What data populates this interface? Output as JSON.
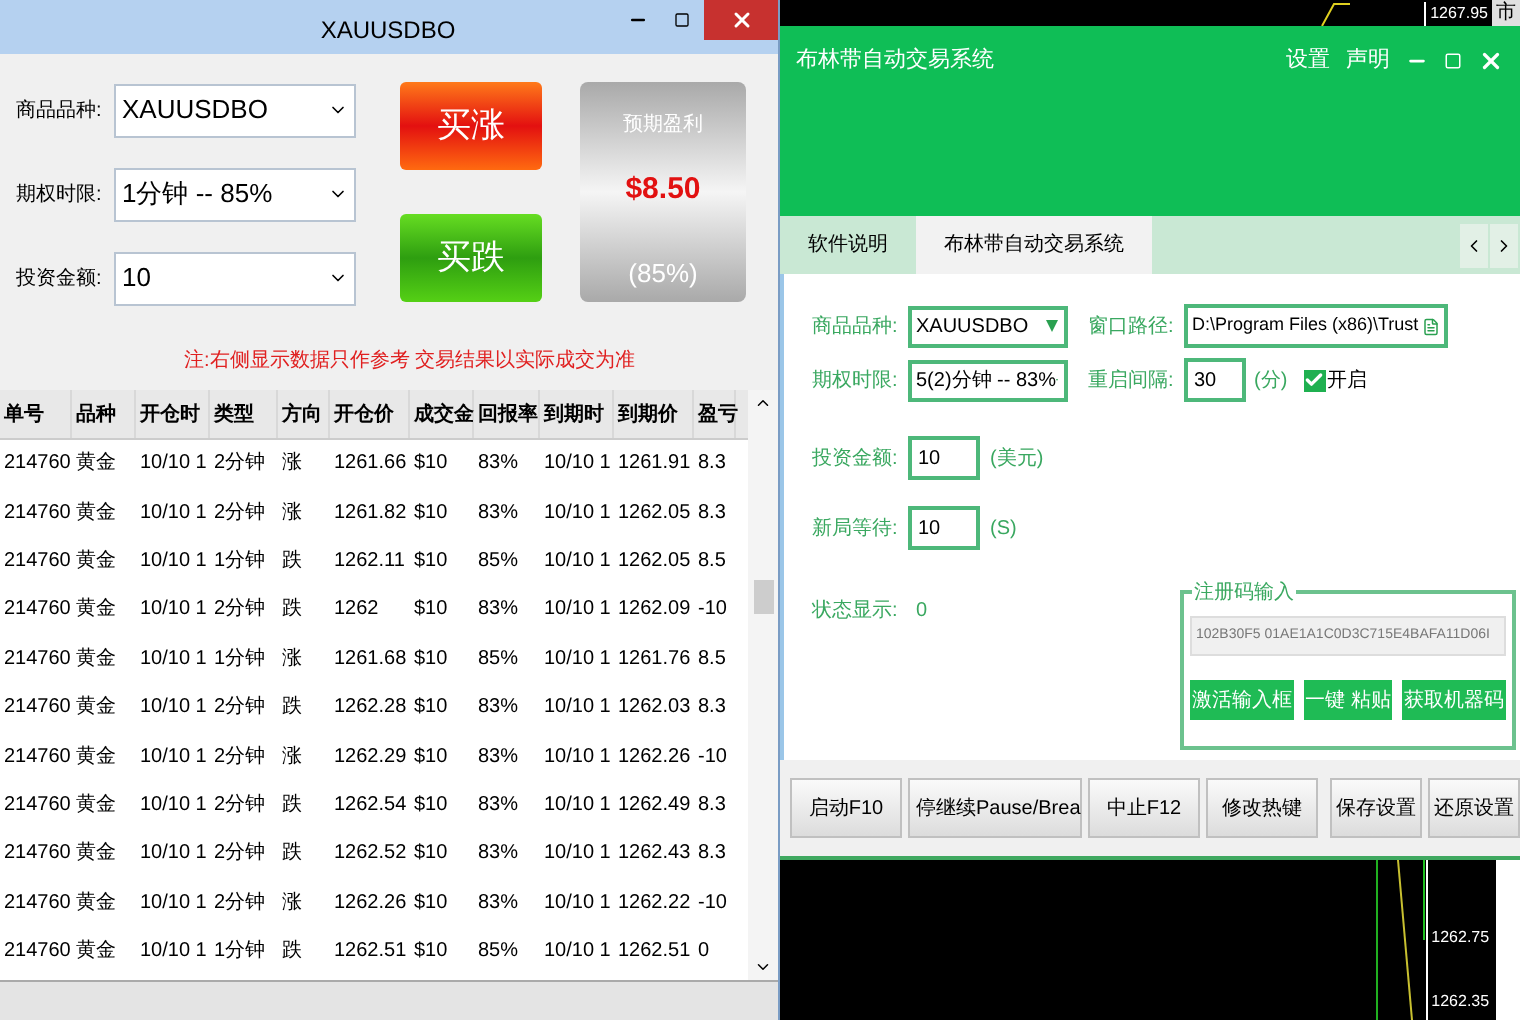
{
  "left_window": {
    "title": "XAUUSDBO",
    "fields": [
      {
        "label": "商品品种:",
        "value": "XAUUSDBO"
      },
      {
        "label": "期权时限:",
        "value": "1分钟 -- 85%"
      },
      {
        "label": "投资金额:",
        "value": "10"
      }
    ],
    "buy_up": "买涨",
    "buy_down": "买跌",
    "profit": {
      "title": "预期盈利",
      "amount": "$8.50",
      "rate": "(85%)"
    },
    "note": "注:右侧显示数据只作参考 交易结果以实际成交为准",
    "table": {
      "columns": [
        "单号",
        "品种",
        "开仓时",
        "类型",
        "方向",
        "开仓价",
        "成交金",
        "回报率",
        "到期时",
        "到期价",
        "盈亏"
      ],
      "rows": [
        [
          "214760",
          "黄金",
          "10/10 1",
          "2分钟",
          "涨",
          "1261.66",
          "$10",
          "83%",
          "10/10 1",
          "1261.91",
          "8.3"
        ],
        [
          "214760",
          "黄金",
          "10/10 1",
          "2分钟",
          "涨",
          "1261.82",
          "$10",
          "83%",
          "10/10 1",
          "1262.05",
          "8.3"
        ],
        [
          "214760",
          "黄金",
          "10/10 1",
          "1分钟",
          "跌",
          "1262.11",
          "$10",
          "85%",
          "10/10 1",
          "1262.05",
          "8.5"
        ],
        [
          "214760",
          "黄金",
          "10/10 1",
          "2分钟",
          "跌",
          "1262",
          "$10",
          "83%",
          "10/10 1",
          "1262.09",
          "-10"
        ],
        [
          "214760",
          "黄金",
          "10/10 1",
          "1分钟",
          "涨",
          "1261.68",
          "$10",
          "85%",
          "10/10 1",
          "1261.76",
          "8.5"
        ],
        [
          "214760",
          "黄金",
          "10/10 1",
          "2分钟",
          "跌",
          "1262.28",
          "$10",
          "83%",
          "10/10 1",
          "1262.03",
          "8.3"
        ],
        [
          "214760",
          "黄金",
          "10/10 1",
          "2分钟",
          "涨",
          "1262.29",
          "$10",
          "83%",
          "10/10 1",
          "1262.26",
          "-10"
        ],
        [
          "214760",
          "黄金",
          "10/10 1",
          "2分钟",
          "跌",
          "1262.54",
          "$10",
          "83%",
          "10/10 1",
          "1262.49",
          "8.3"
        ],
        [
          "214760",
          "黄金",
          "10/10 1",
          "2分钟",
          "跌",
          "1262.52",
          "$10",
          "83%",
          "10/10 1",
          "1262.43",
          "8.3"
        ],
        [
          "214760",
          "黄金",
          "10/10 1",
          "2分钟",
          "涨",
          "1262.26",
          "$10",
          "83%",
          "10/10 1",
          "1262.22",
          "-10"
        ],
        [
          "214760",
          "黄金",
          "10/10 1",
          "1分钟",
          "跌",
          "1262.51",
          "$10",
          "85%",
          "10/10 1",
          "1262.51",
          "0"
        ]
      ]
    }
  },
  "right_window": {
    "chart_top": {
      "price": "1267.95",
      "label": "市"
    },
    "title": "布林带自动交易系统",
    "header_links": [
      "设置",
      "声明"
    ],
    "tabs": [
      {
        "label": "软件说明",
        "selected": false
      },
      {
        "label": "布林带自动交易系统",
        "selected": true
      }
    ],
    "product": {
      "label": "商品品种:",
      "value": "XAUUSDBO"
    },
    "path": {
      "label": "窗口路径:",
      "value": "D:\\Program Files (x86)\\Trust"
    },
    "period": {
      "label": "期权时限:",
      "value": "5(2)分钟 -- 83%"
    },
    "restart": {
      "label": "重启间隔:",
      "value": "30",
      "unit": "(分)"
    },
    "enable": {
      "label": "开启",
      "checked": true
    },
    "amount": {
      "label": "投资金额:",
      "value": "10",
      "unit": "(美元)"
    },
    "wait": {
      "label": "新局等待:",
      "value": "10",
      "unit": "(S)"
    },
    "status": {
      "label": "状态显示:",
      "value": "0"
    },
    "registration": {
      "title": "注册码输入",
      "code": "102B30F5 01AE1A1C0D3C715E4BAFA11D06I",
      "buttons": [
        "激活输入框",
        "一键 粘贴",
        "获取机器码"
      ]
    },
    "actions": [
      "启动F10",
      "停继续Pause/Brea",
      "中止F12",
      "修改热键"
    ],
    "settings_actions": [
      "保存设置",
      "还原设置"
    ],
    "chart_bottom": {
      "prices": [
        "1262.75",
        "1262.35"
      ]
    }
  }
}
